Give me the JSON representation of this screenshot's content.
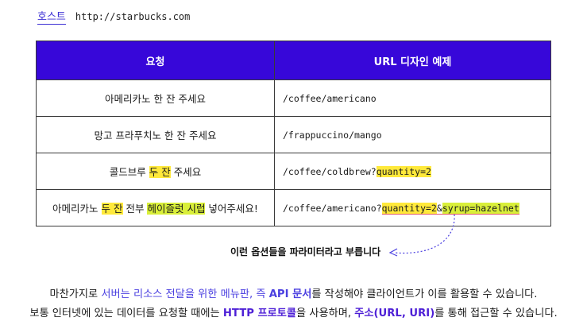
{
  "host": {
    "label": "호스트",
    "url": "http://starbucks.com"
  },
  "table": {
    "headers": [
      "요청",
      "URL 디자인 예제"
    ],
    "rows": [
      {
        "request": {
          "before": "아메리카노 한 잔 주세요"
        },
        "url": {
          "base": "/coffee/americano"
        }
      },
      {
        "request": {
          "before": "망고 프라푸치노 한 잔 주세요"
        },
        "url": {
          "base": "/frappuccino/mango"
        }
      },
      {
        "request": {
          "before": "콜드브루 ",
          "hl1": "두 잔",
          "after": " 주세요"
        },
        "url": {
          "base": "/coffee/coldbrew?",
          "p1": "quantity=2"
        }
      },
      {
        "request": {
          "before": "아메리카노 ",
          "hl1": "두 잔",
          "mid": " 전부 ",
          "hl2": "헤이즐럿 시럽",
          "after": " 넣어주세요!"
        },
        "url": {
          "base": "/coffee/americano?",
          "p1": "quantity=2",
          "amp": "&",
          "p2": "syrup=hazelnet"
        }
      }
    ]
  },
  "annotation": "이런 옵션들을 파라미터라고 부릅니다",
  "paragraph1": {
    "t1": "마찬가지로 ",
    "t2": "서버는 리소스 전달을 위한 메뉴판, 즉 ",
    "t3": "API 문서",
    "t4": "를 작성해야 클라이언트가 이를 활용할 수 있습니다."
  },
  "paragraph2": {
    "t1": "보통 인터넷에 있는 데이터를 요청할 때에는 ",
    "t2": "HTTP 프로토콜",
    "t3": "을 사용하며, ",
    "t4": "주소(URL, URI)",
    "t5": "를 통해 접근할 수 있습니다."
  },
  "colors": {
    "header_bg": "#3707d9",
    "highlight_yellow": "#ffe93b",
    "highlight_green": "#d9ef3a",
    "accent_blue": "#4a3fe0",
    "underline_red": "#e05a6a"
  }
}
